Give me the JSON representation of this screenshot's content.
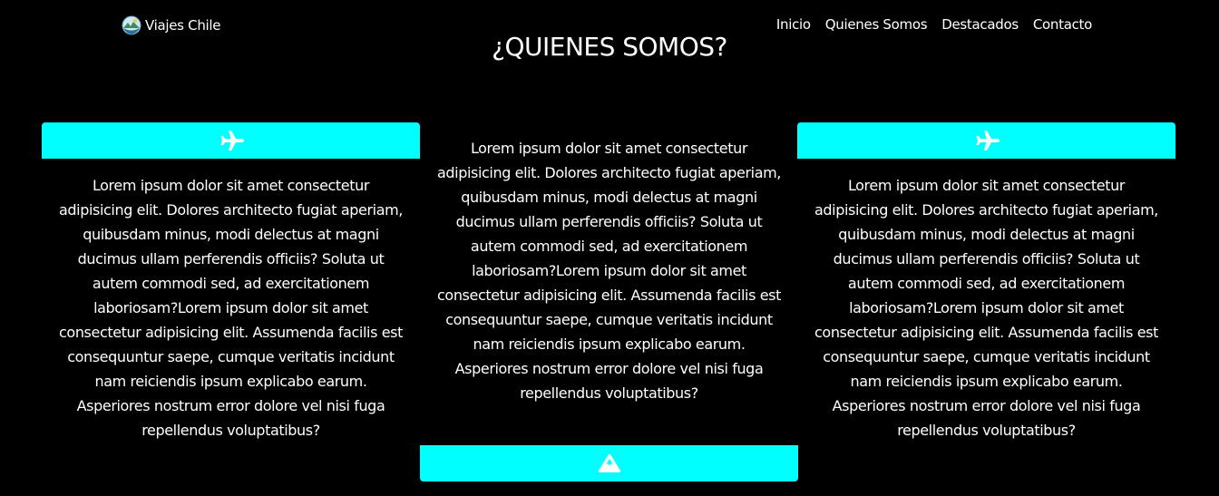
{
  "brand": {
    "name": "Viajes Chile",
    "logo_icon": "globe-landscape-icon"
  },
  "nav": {
    "items": [
      "Inicio",
      "Quienes Somos",
      "Destacados",
      "Contacto"
    ]
  },
  "section": {
    "title": "¿QUIENES SOMOS?"
  },
  "colors": {
    "background": "#000000",
    "accent": "#00ffff",
    "text": "#ffffff"
  },
  "cards": [
    {
      "icon": "airplane-icon",
      "text": "Lorem ipsum dolor sit amet consectetur adipisicing elit. Dolores architecto fugiat aperiam, quibusdam minus, modi delectus at magni ducimus ullam perferendis officiis? Soluta ut autem commodi sed, ad exercitationem laboriosam?Lorem ipsum dolor sit amet consectetur adipisicing elit. Assumenda facilis est consequuntur saepe, cumque veritatis incidunt nam reiciendis ipsum explicabo earum. Asperiores nostrum error dolore vel nisi fuga repellendus voluptatibus?"
    },
    {
      "icon": "mountain-icon",
      "text": "Lorem ipsum dolor sit amet consectetur adipisicing elit. Dolores architecto fugiat aperiam, quibusdam minus, modi delectus at magni ducimus ullam perferendis officiis? Soluta ut autem commodi sed, ad exercitationem laboriosam?Lorem ipsum dolor sit amet consectetur adipisicing elit. Assumenda facilis est consequuntur saepe, cumque veritatis incidunt nam reiciendis ipsum explicabo earum. Asperiores nostrum error dolore vel nisi fuga repellendus voluptatibus?"
    },
    {
      "icon": "airplane-icon",
      "text": "Lorem ipsum dolor sit amet consectetur adipisicing elit. Dolores architecto fugiat aperiam, quibusdam minus, modi delectus at magni ducimus ullam perferendis officiis? Soluta ut autem commodi sed, ad exercitationem laboriosam?Lorem ipsum dolor sit amet consectetur adipisicing elit. Assumenda facilis est consequuntur saepe, cumque veritatis incidunt nam reiciendis ipsum explicabo earum. Asperiores nostrum error dolore vel nisi fuga repellendus voluptatibus?"
    }
  ]
}
